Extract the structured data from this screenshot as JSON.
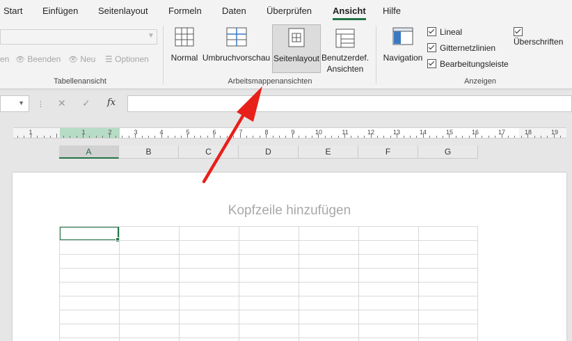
{
  "tabs": [
    "Start",
    "Einfügen",
    "Seitenlayout",
    "Formeln",
    "Daten",
    "Überprüfen",
    "Ansicht",
    "Hilfe"
  ],
  "active_tab": "Ansicht",
  "tabellenansicht": {
    "beenden": "Beenden",
    "neu": "Neu",
    "optionen": "Optionen",
    "truncated": "en",
    "label": "Tabellenansicht"
  },
  "arbeitsmappenansichten": {
    "normal": "Normal",
    "umbruchvorschau": "Umbruchvorschau",
    "seitenlayout": "Seitenlayout",
    "benutzerdef_line1": "Benutzerdef.",
    "benutzerdef_line2": "Ansichten",
    "label": "Arbeitsmappenansichten"
  },
  "anzeigen": {
    "navigation": "Navigation",
    "lineal": "Lineal",
    "gitternetzlinien": "Gitternetzlinien",
    "bearbeitungsleiste": "Bearbeitungsleiste",
    "ueberschriften": "Überschriften",
    "label": "Anzeigen"
  },
  "formula_bar": {
    "fx": "fx",
    "cancel": "✕",
    "enter": "✓"
  },
  "ruler_numbers": [
    "1",
    "1",
    "2",
    "3",
    "4",
    "5",
    "6",
    "7",
    "8",
    "9",
    "10",
    "11",
    "12",
    "13",
    "14",
    "15",
    "16",
    "17",
    "18",
    "19"
  ],
  "columns": [
    "A",
    "B",
    "C",
    "D",
    "E",
    "F",
    "G"
  ],
  "page": {
    "header_placeholder": "Kopfzeile hinzufügen"
  },
  "colors": {
    "accent": "#217346",
    "annotation_arrow": "#e8201a"
  }
}
